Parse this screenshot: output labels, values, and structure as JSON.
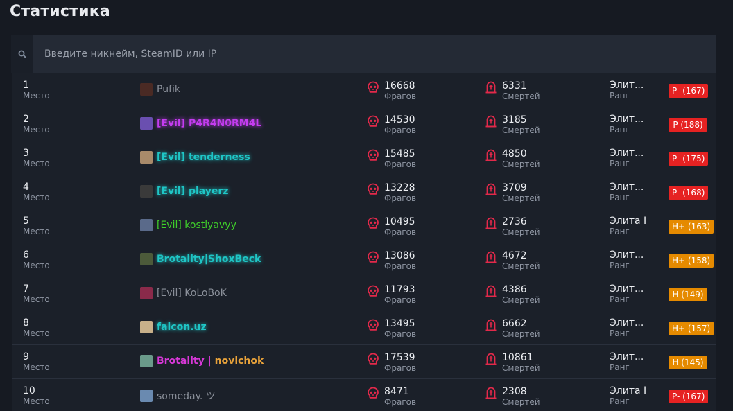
{
  "title": "Статистика",
  "search": {
    "placeholder": "Введите никнейм, SteamID или IP"
  },
  "colors": {
    "accent_red": "#e3294a",
    "badge_red": "#e62222",
    "badge_orange": "#e58a00"
  },
  "icons": {
    "search": "search-icon",
    "frags": "skull-icon",
    "deaths": "tombstone-icon"
  },
  "rows": [
    {
      "place": "1",
      "place_label": "Место",
      "name": "Pufik",
      "name_color": "#8a8f99",
      "glow": false,
      "avatar": "#4a2a24",
      "frags": "16668",
      "frags_label": "Фрагов",
      "deaths": "6331",
      "deaths_label": "Смертей",
      "rank": "Элит...",
      "rank_label": "Ранг",
      "badge": "P- (167)",
      "badge_color": "#e62222"
    },
    {
      "place": "2",
      "place_label": "Место",
      "name": "[Evil] P4R4N0RM4L",
      "name_color": "#c43cf0",
      "glow": true,
      "avatar": "#6a4fb0",
      "frags": "14530",
      "frags_label": "Фрагов",
      "deaths": "3185",
      "deaths_label": "Смертей",
      "rank": "Элит...",
      "rank_label": "Ранг",
      "badge": "P (188)",
      "badge_color": "#e62222"
    },
    {
      "place": "3",
      "place_label": "Место",
      "name": "[Evil] tenderness",
      "name_color": "#1fc6c6",
      "glow": true,
      "avatar": "#a88a6a",
      "frags": "15485",
      "frags_label": "Фрагов",
      "deaths": "4850",
      "deaths_label": "Смертей",
      "rank": "Элит...",
      "rank_label": "Ранг",
      "badge": "P- (175)",
      "badge_color": "#e62222"
    },
    {
      "place": "4",
      "place_label": "Место",
      "name": "[Evil] playerz",
      "name_color": "#1fc6c6",
      "glow": true,
      "avatar": "#3a3a3a",
      "frags": "13228",
      "frags_label": "Фрагов",
      "deaths": "3709",
      "deaths_label": "Смертей",
      "rank": "Элит...",
      "rank_label": "Ранг",
      "badge": "P- (168)",
      "badge_color": "#e62222"
    },
    {
      "place": "5",
      "place_label": "Место",
      "name": "[Evil] kostlyavyy",
      "name_color": "#3fcf2a",
      "glow": false,
      "avatar": "#5a6a8a",
      "frags": "10495",
      "frags_label": "Фрагов",
      "deaths": "2736",
      "deaths_label": "Смертей",
      "rank": "Элита I",
      "rank_label": "Ранг",
      "badge": "H+ (163)",
      "badge_color": "#e58a00"
    },
    {
      "place": "6",
      "place_label": "Место",
      "name": "Brotality|ShoxBeck",
      "name_color": "#1fc6c6",
      "glow": true,
      "avatar": "#4c5a3a",
      "frags": "13086",
      "frags_label": "Фрагов",
      "deaths": "4672",
      "deaths_label": "Смертей",
      "rank": "Элит...",
      "rank_label": "Ранг",
      "badge": "H+ (158)",
      "badge_color": "#e58a00"
    },
    {
      "place": "7",
      "place_label": "Место",
      "name": "[Evil] KoLoBoK",
      "name_color": "#8a8f99",
      "glow": false,
      "avatar": "#8a2a4a",
      "frags": "11793",
      "frags_label": "Фрагов",
      "deaths": "4386",
      "deaths_label": "Смертей",
      "rank": "Элит...",
      "rank_label": "Ранг",
      "badge": "H (149)",
      "badge_color": "#e58a00"
    },
    {
      "place": "8",
      "place_label": "Место",
      "name": "falcon.uz",
      "name_color": "#1fc6c6",
      "glow": true,
      "avatar": "#c8b08a",
      "frags": "13495",
      "frags_label": "Фрагов",
      "deaths": "6662",
      "deaths_label": "Смертей",
      "rank": "Элит...",
      "rank_label": "Ранг",
      "badge": "H+ (157)",
      "badge_color": "#e58a00"
    },
    {
      "place": "9",
      "place_label": "Место",
      "name": "Brotality | novichok",
      "name_color": "#d838d8",
      "glow": false,
      "avatar": "#6a9a8a",
      "name_color2": "#e8a23a",
      "frags": "17539",
      "frags_label": "Фрагов",
      "deaths": "10861",
      "deaths_label": "Смертей",
      "rank": "Элит...",
      "rank_label": "Ранг",
      "badge": "H (145)",
      "badge_color": "#e58a00"
    },
    {
      "place": "10",
      "place_label": "Место",
      "name": "someday. ツ",
      "name_color": "#8a8f99",
      "glow": false,
      "avatar": "#6a8ab0",
      "frags": "8471",
      "frags_label": "Фрагов",
      "deaths": "2308",
      "deaths_label": "Смертей",
      "rank": "Элита I",
      "rank_label": "Ранг",
      "badge": "P- (167)",
      "badge_color": "#e62222"
    }
  ]
}
